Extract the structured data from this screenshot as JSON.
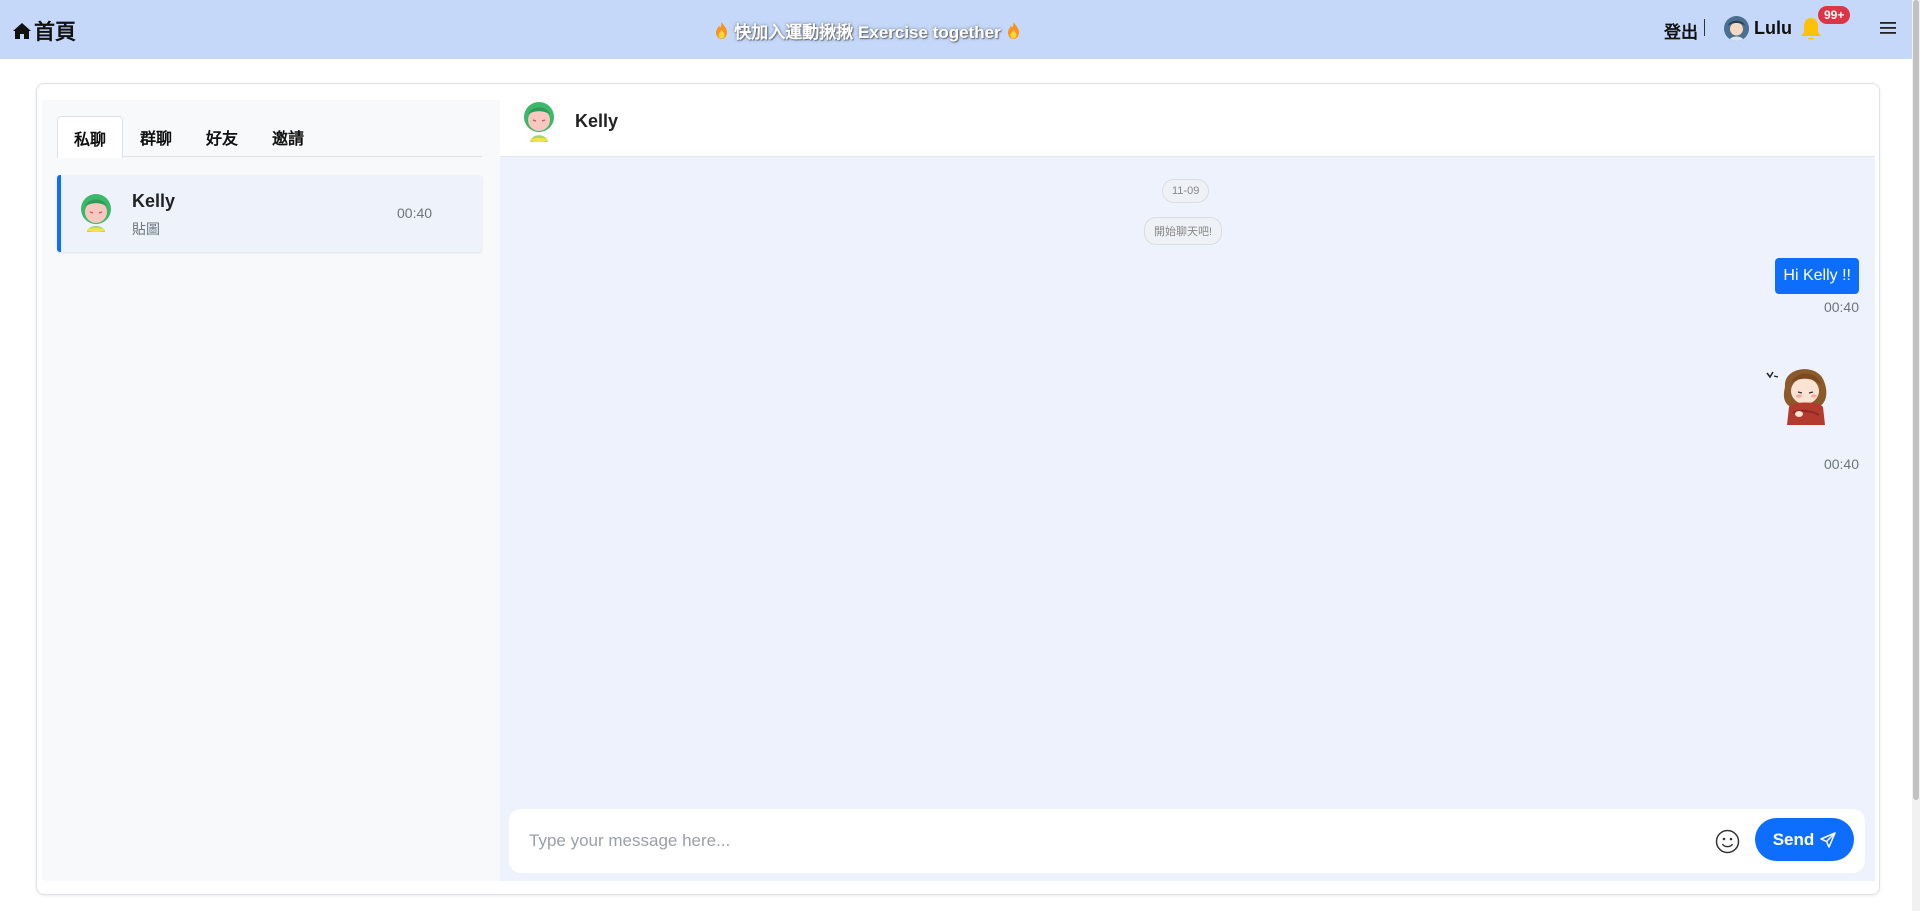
{
  "navbar": {
    "brand": "首頁",
    "banner": "快加入運動揪揪 Exercise together",
    "logout": "登出",
    "username": "Lulu",
    "notification_badge": "99+"
  },
  "sidebar": {
    "tabs": [
      {
        "label": "私聊",
        "active": true
      },
      {
        "label": "群聊",
        "active": false
      },
      {
        "label": "好友",
        "active": false
      },
      {
        "label": "邀請",
        "active": false
      }
    ],
    "chats": [
      {
        "name": "Kelly",
        "last_message": "貼圖",
        "time": "00:40"
      }
    ]
  },
  "chat": {
    "header_name": "Kelly",
    "date_pill": "11-09",
    "start_pill": "開始聊天吧!",
    "messages": [
      {
        "type": "text",
        "text": "Hi Kelly !!",
        "time": "00:40"
      },
      {
        "type": "sticker",
        "text": "",
        "time": "00:40"
      }
    ],
    "input_placeholder": "Type your message here...",
    "send_label": "Send"
  },
  "colors": {
    "navbar_bg": "#c5d8f9",
    "accent": "#0d6efd",
    "badge": "#dc3545",
    "bell": "#ffc107"
  }
}
